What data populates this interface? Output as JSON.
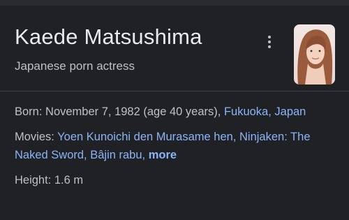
{
  "header": {
    "title": "Kaede Matsushima",
    "subtitle": "Japanese porn actress"
  },
  "menu_icon": "more-vert-icon",
  "facts": {
    "born": {
      "label": "Born:",
      "value": "November 7, 1982 (age 40 years),",
      "place": "Fukuoka, Japan"
    },
    "movies": {
      "label": "Movies:",
      "items": [
        "Yoen Kunoichi den Murasame hen,",
        "Ninjaken: The Naked Sword,",
        "Bâjin rabu,"
      ],
      "more": "more"
    },
    "height": {
      "label": "Height:",
      "value": "1.6 m"
    }
  },
  "colors": {
    "background": "#202124",
    "text_primary": "#e8eaed",
    "text_secondary": "#bdc1c6",
    "link": "#8ab4f8",
    "divider": "#3c4043"
  }
}
